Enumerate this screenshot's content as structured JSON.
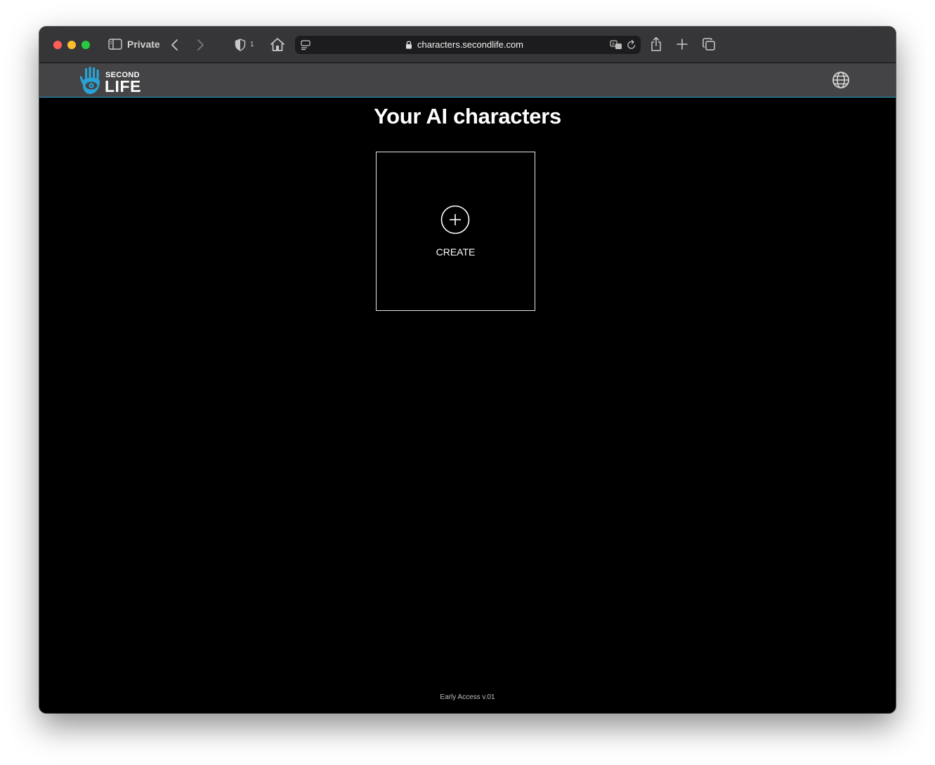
{
  "browser": {
    "private_label": "Private",
    "tracker_count": "1",
    "url": "characters.secondlife.com"
  },
  "site": {
    "logo": {
      "second": "SECOND",
      "life": "LIFE",
      "color": "#29a3d6"
    },
    "accent_color": "#29a3d6"
  },
  "main": {
    "title": "Your AI characters",
    "create_label": "CREATE"
  },
  "footer": {
    "version": "Early Access v.01"
  }
}
